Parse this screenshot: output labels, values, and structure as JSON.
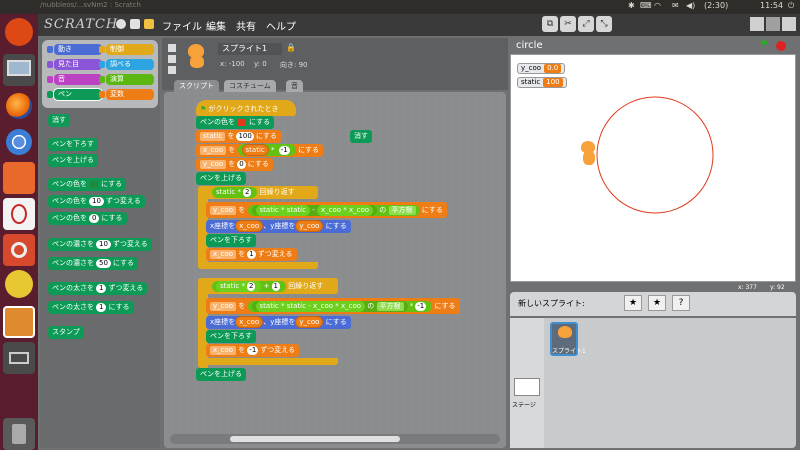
{
  "topbar": {
    "window_title": "/nubbleos/...svNm2 : Scratch",
    "volume": "◀)",
    "battery": "(2:30)",
    "clock": "11:54",
    "power": "⏻"
  },
  "app": {
    "logo": "SCRATCH",
    "menus": [
      "ファイル",
      "編集",
      "共有",
      "ヘルプ"
    ]
  },
  "categories": [
    {
      "label": "動き",
      "color": "#4a6cd4"
    },
    {
      "label": "制御",
      "color": "#e1a91a"
    },
    {
      "label": "見た目",
      "color": "#8a55d7"
    },
    {
      "label": "調べる",
      "color": "#2ca5e2"
    },
    {
      "label": "音",
      "color": "#bb42c3"
    },
    {
      "label": "演算",
      "color": "#5cb712"
    },
    {
      "label": "ペン",
      "color": "#0d9a56"
    },
    {
      "label": "変数",
      "color": "#ee7d16"
    }
  ],
  "palette": {
    "clear": "消す",
    "pen_down": "ペンを下ろす",
    "pen_up": "ペンを上げる",
    "set_pen_color_prefix": "ペンの色を",
    "set_pen_color_suffix": "にする",
    "change_color_prefix": "ペンの色を",
    "change_color_value": "10",
    "change_color_suffix": "ずつ変える",
    "set_color_prefix": "ペンの色を",
    "set_color_value": "0",
    "set_color_suffix": "にする",
    "change_shade_prefix": "ペンの濃さを",
    "change_shade_value": "10",
    "change_shade_suffix": "ずつ変える",
    "set_shade_prefix": "ペンの濃さを",
    "set_shade_value": "50",
    "set_shade_suffix": "にする",
    "change_size_prefix": "ペンの太さを",
    "change_size_value": "1",
    "change_size_suffix": "ずつ変える",
    "set_size_prefix": "ペンの太さを",
    "set_size_value": "1",
    "set_size_suffix": "にする",
    "stamp": "スタンプ"
  },
  "sprite": {
    "name": "スプライト1",
    "x_label": "x: -100",
    "y_label": "y: 0",
    "direction_label": "向き: 90"
  },
  "tabs": [
    "スクリプト",
    "コスチューム",
    "音"
  ],
  "script": {
    "hat": "がクリックされたとき",
    "pen_color": "ペンの色を",
    "pen_color_suffix": "にする",
    "set1_var": "static",
    "set1_mid": "を",
    "set1_val": "100",
    "set1_suffix": "にする",
    "set2_var": "x_coo",
    "set2_mid": "を",
    "set2_op_a": "static",
    "set2_op_sym": "*",
    "set2_op_b": "-1",
    "set2_suffix": "にする",
    "set3_var": "y_coo",
    "set3_mid": "を",
    "set3_val": "0",
    "set3_suffix": "にする",
    "pen_up1": "ペンを上げる",
    "repeat1_a": "static",
    "repeat1_sym": "*",
    "repeat1_b": "2",
    "repeat1_suffix": "回繰り返す",
    "r1_set_var": "y_coo",
    "r1_set_mid": "を",
    "r1_a": "static",
    "r1_sym1": "*",
    "r1_b": "static",
    "r1_sym2": "-",
    "r1_c": "x_coo",
    "r1_sym3": "*",
    "r1_d": "x_coo",
    "r1_of": "の",
    "r1_func": "平方根",
    "r1_suffix": "にする",
    "r1_goto_x": "x座標を",
    "r1_goto_xv": "x_coo",
    "r1_goto_y": "、y座標を",
    "r1_goto_yv": "y_coo",
    "r1_goto_suffix": "にする",
    "r1_pendown": "ペンを下ろす",
    "r1_change_var": "x_coo",
    "r1_change_mid": "を",
    "r1_change_val": "1",
    "r1_change_suffix": "ずつ変える",
    "repeat2_a": "static",
    "repeat2_sym1": "*",
    "repeat2_b": "2",
    "repeat2_sym2": "+",
    "repeat2_c": "1",
    "repeat2_suffix": "回繰り返す",
    "r2_set_var": "y_coo",
    "r2_set_mid": "を",
    "r2_a": "static",
    "r2_sym1": "*",
    "r2_b": "static",
    "r2_sym2": "-",
    "r2_c": "x_coo",
    "r2_sym3": "*",
    "r2_d": "x_coo",
    "r2_of": "の",
    "r2_func": "平方根",
    "r2_sym4": "*",
    "r2_e": "-1",
    "r2_suffix": "にする",
    "r2_goto_x": "x座標を",
    "r2_goto_xv": "x_coo",
    "r2_goto_y": "、y座標を",
    "r2_goto_yv": "y_coo",
    "r2_goto_suffix": "にする",
    "r2_pendown": "ペンを下ろす",
    "r2_change_var": "x_coo",
    "r2_change_mid": "を",
    "r2_change_val": "-1",
    "r2_change_suffix": "ずつ変える",
    "pen_up2": "ペンを上げる",
    "loose_clear": "消す"
  },
  "stage": {
    "title": "circle",
    "watchers": [
      {
        "name": "y_coo",
        "value": "0.0"
      },
      {
        "name": "static",
        "value": "100"
      }
    ],
    "mouse_x": "x: 377",
    "mouse_y": "y: 92",
    "pen_color": "#e03a1a"
  },
  "spritelib": {
    "new_sprite_label": "新しいスプライト:",
    "sprite_name": "スプライト1",
    "stage_name": "ステージ"
  }
}
